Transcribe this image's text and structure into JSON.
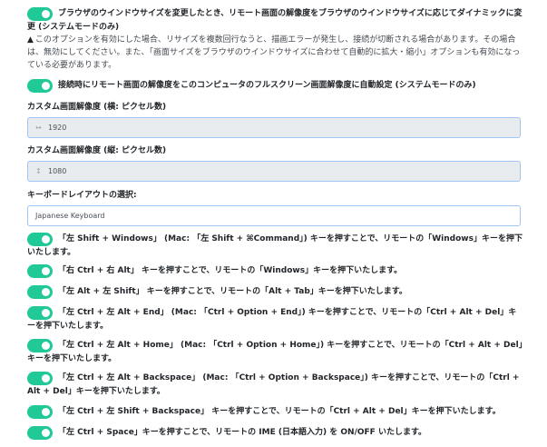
{
  "colors": {
    "toggle_on": "#20c997",
    "field_border": "#9ec5f4",
    "disabled_bg": "#e9ecef"
  },
  "options": [
    {
      "text": "ブラウザのウインドウサイズを変更したとき、リモート画面の解像度をブラウザのウインドウサイズに応じてダイナミックに変更 (システムモードのみ)",
      "checked": true
    },
    {
      "text": "接続時にリモート画面の解像度をこのコンピュータのフルスクリーン画面解像度に自動設定 (システムモードのみ)",
      "checked": true
    }
  ],
  "warning": {
    "icon": "warning-triangle-icon",
    "text": "このオプションを有効にした場合、リサイズを複数回行なうと、描画エラーが発生し、接続が切断される場合があります。その場合は、無効にしてください。また、「画面サイズをブラウザのウインドウサイズに合わせて自動的に拡大・縮小」オプションも有効になっている必要があります。"
  },
  "width_field": {
    "label": "カスタム画面解像度 (横: ピクセル数)",
    "value": "1920",
    "icon": "horizontal-arrows-icon"
  },
  "height_field": {
    "label": "カスタム画面解像度 (縦: ピクセル数)",
    "value": "1080",
    "icon": "vertical-arrows-icon"
  },
  "keyboard": {
    "label": "キーボードレイアウトの選択:",
    "value": "Japanese Keyboard"
  },
  "shortcuts": [
    {
      "text": "「左 Shift + Windows」 (Mac: 「左 Shift + ⌘Command」) キーを押すことで、リモートの「Windows」キーを押下いたします。",
      "checked": true
    },
    {
      "text": "「右 Ctrl + 右 Alt」 キーを押すことで、リモートの「Windows」キーを押下いたします。",
      "checked": true
    },
    {
      "text": "「左 Alt + 左 Shift」 キーを押すことで、リモートの「Alt + Tab」キーを押下いたします。",
      "checked": true
    },
    {
      "text": "「左 Ctrl + 左 Alt + End」 (Mac: 「Ctrl + Option + End」) キーを押すことで、リモートの「Ctrl + Alt + Del」キーを押下いたします。",
      "checked": true
    },
    {
      "text": "「左 Ctrl + 左 Alt + Home」 (Mac: 「Ctrl + Option + Home」) キーを押すことで、リモートの「Ctrl + Alt + Del」キーを押下いたします。",
      "checked": true
    },
    {
      "text": "「左 Ctrl + 左 Alt + Backspace」 (Mac: 「Ctrl + Option + Backspace」) キーを押すことで、リモートの「Ctrl + Alt + Del」キーを押下いたします。",
      "checked": true
    },
    {
      "text": "「左 Ctrl + 左 Shift + Backspace」 キーを押すことで、リモートの「Ctrl + Alt + Del」キーを押下いたします。",
      "checked": true
    },
    {
      "text": "「左 Ctrl + Space」キーを押すことで、リモートの IME (日本語入力) を ON/OFF いたします。",
      "checked": true
    }
  ]
}
